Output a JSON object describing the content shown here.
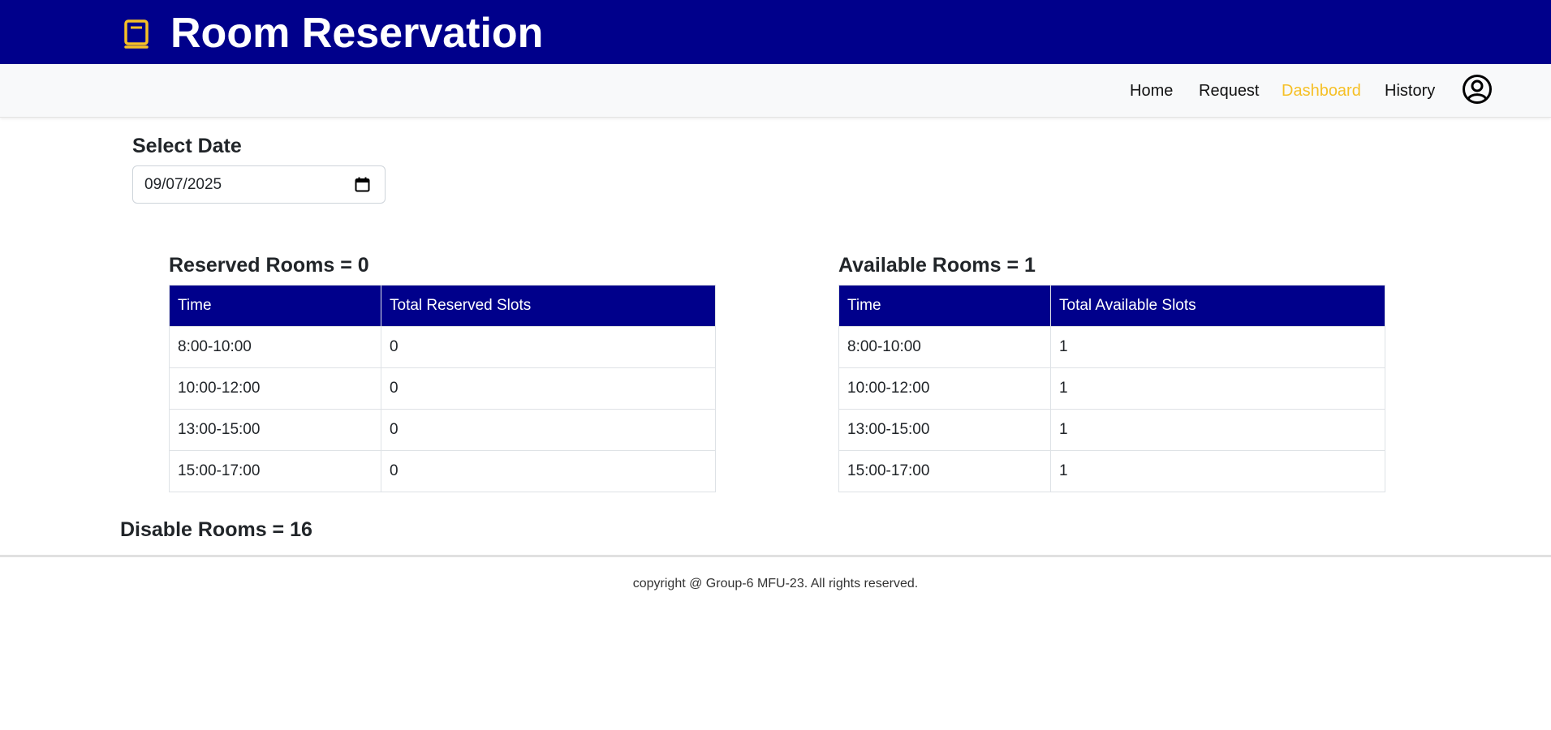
{
  "header": {
    "title": "Room Reservation",
    "brand_icon": "book-icon",
    "brand_color": "#f6c026",
    "background": "#00008b"
  },
  "nav": {
    "items": [
      {
        "label": "Home",
        "active": false
      },
      {
        "label": "Request",
        "active": false
      },
      {
        "label": "Dashboard",
        "active": true
      },
      {
        "label": "History",
        "active": false
      }
    ],
    "active_color": "#f6c026",
    "profile_icon": "user-circle-icon"
  },
  "date_picker": {
    "label": "Select Date",
    "value": "09/07/2025",
    "icon": "calendar-icon"
  },
  "reserved": {
    "heading": "Reserved Rooms = 0",
    "columns": [
      "Time",
      "Total Reserved Slots"
    ],
    "rows": [
      [
        "8:00-10:00",
        "0"
      ],
      [
        "10:00-12:00",
        "0"
      ],
      [
        "13:00-15:00",
        "0"
      ],
      [
        "15:00-17:00",
        "0"
      ]
    ]
  },
  "available": {
    "heading": "Available Rooms = 1",
    "columns": [
      "Time",
      "Total Available Slots"
    ],
    "rows": [
      [
        "8:00-10:00",
        "1"
      ],
      [
        "10:00-12:00",
        "1"
      ],
      [
        "13:00-15:00",
        "1"
      ],
      [
        "15:00-17:00",
        "1"
      ]
    ]
  },
  "disabled": {
    "heading": "Disable Rooms = 16"
  },
  "footer": {
    "text": "copyright @ Group-6 MFU-23. All rights reserved."
  }
}
